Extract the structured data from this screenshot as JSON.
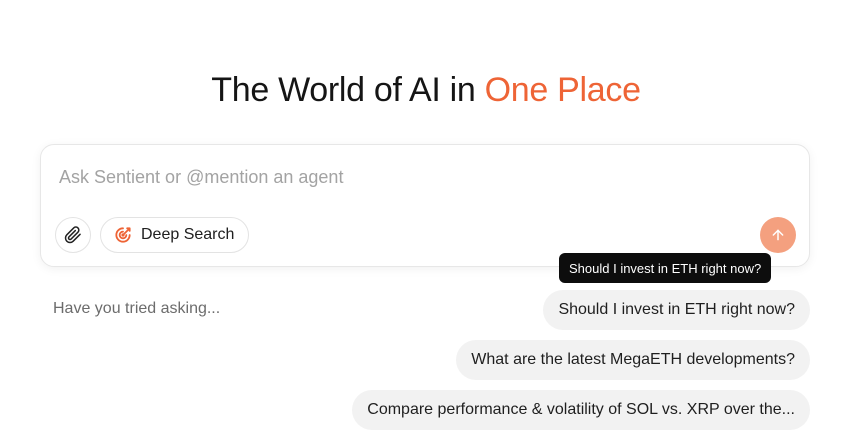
{
  "hero": {
    "title_prefix": "The World of AI in ",
    "title_accent": "One Place"
  },
  "composer": {
    "placeholder": "Ask Sentient or @mention an agent",
    "value": "",
    "attach_icon": "paperclip-icon",
    "deep_search_label": "Deep Search",
    "deep_search_icon": "target-search-icon",
    "send_icon": "arrow-up-icon"
  },
  "suggestions": {
    "label": "Have you tried asking...",
    "items": [
      "Should I invest in ETH right now?",
      "What are the latest MegaETH developments?",
      "Compare performance & volatility of SOL vs. XRP over the..."
    ]
  },
  "tooltip": {
    "text": "Should I invest in ETH right now?"
  },
  "colors": {
    "accent": "#ee6436",
    "send_button": "#f4a07f",
    "chip_bg": "#f2f2f2",
    "tooltip_bg": "#0d0d0d"
  }
}
